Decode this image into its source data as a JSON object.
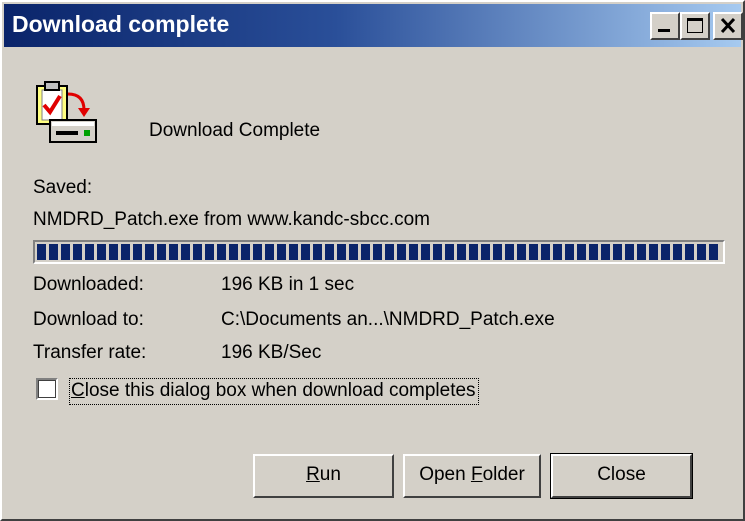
{
  "window": {
    "title": "Download complete",
    "controls": {
      "minimize": "minimize-icon",
      "maximize": "maximize-icon",
      "close": "close-icon"
    }
  },
  "header": {
    "icon": "download-complete-icon",
    "label": "Download Complete"
  },
  "saved": {
    "label": "Saved:",
    "file": "NMDRD_Patch.exe from www.kandc-sbcc.com"
  },
  "progress": {
    "percent": 100,
    "color": "#0a246a"
  },
  "details": [
    {
      "label": "Downloaded:",
      "value": "196 KB in 1 sec"
    },
    {
      "label": "Download to:",
      "value": "C:\\Documents an...\\NMDRD_Patch.exe"
    },
    {
      "label": "Transfer rate:",
      "value": "196 KB/Sec"
    }
  ],
  "option": {
    "checked": false,
    "mnemonic": "C",
    "rest": "lose this dialog box when download completes"
  },
  "buttons": {
    "run": {
      "mnemonic": "R",
      "rest": "un"
    },
    "open_folder": {
      "before": "Open ",
      "mnemonic": "F",
      "rest": "older"
    },
    "close": {
      "label": "Close"
    }
  },
  "colors": {
    "titlebar_start": "#0a246a",
    "titlebar_end": "#a6caf0",
    "face": "#d4d0c8"
  }
}
